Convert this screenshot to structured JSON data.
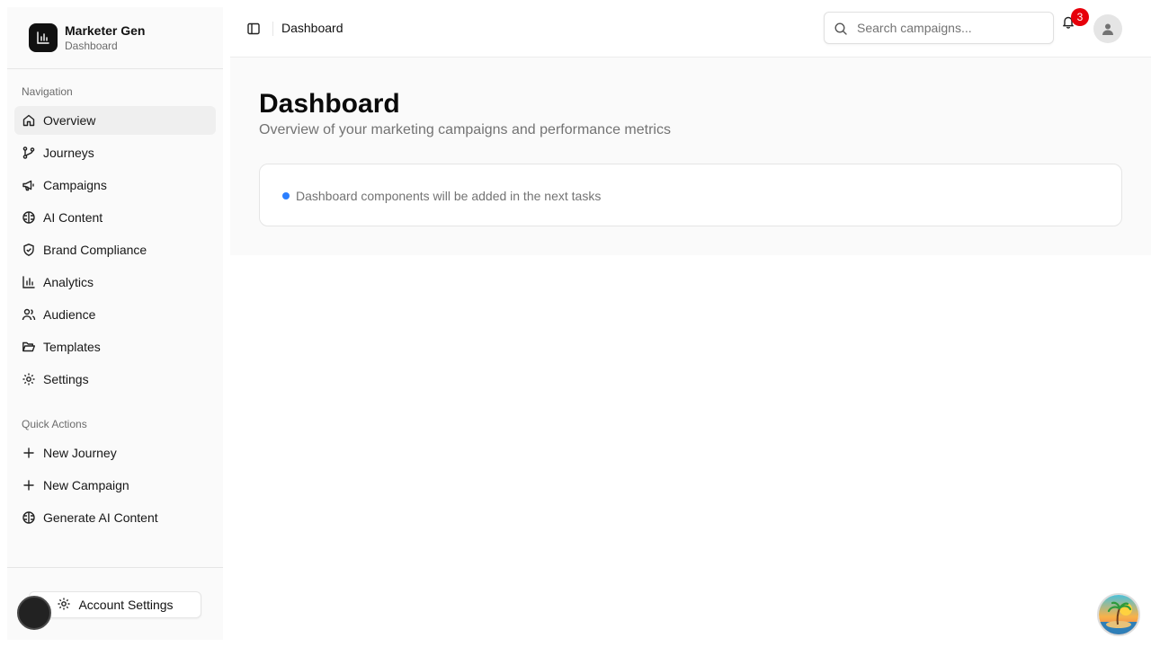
{
  "brand": {
    "title": "Marketer Gen",
    "subtitle": "Dashboard"
  },
  "sidebar": {
    "nav_label": "Navigation",
    "nav_items": [
      {
        "label": "Overview",
        "icon": "home-icon",
        "active": true
      },
      {
        "label": "Journeys",
        "icon": "git-branch-icon"
      },
      {
        "label": "Campaigns",
        "icon": "megaphone-icon"
      },
      {
        "label": "AI Content",
        "icon": "brain-icon"
      },
      {
        "label": "Brand Compliance",
        "icon": "shield-check-icon"
      },
      {
        "label": "Analytics",
        "icon": "bar-chart-icon"
      },
      {
        "label": "Audience",
        "icon": "users-icon"
      },
      {
        "label": "Templates",
        "icon": "folder-open-icon"
      },
      {
        "label": "Settings",
        "icon": "gear-icon"
      }
    ],
    "quick_label": "Quick Actions",
    "quick_items": [
      {
        "label": "New Journey",
        "icon": "plus-icon"
      },
      {
        "label": "New Campaign",
        "icon": "plus-icon"
      },
      {
        "label": "Generate AI Content",
        "icon": "brain-icon"
      }
    ],
    "account_button": "Account Settings"
  },
  "header": {
    "title": "Dashboard",
    "search_placeholder": "Search campaigns...",
    "notification_count": "3"
  },
  "main": {
    "title": "Dashboard",
    "subtitle": "Overview of your marketing campaigns and performance metrics",
    "notice": "Dashboard components will be added in the next tasks"
  },
  "colors": {
    "accent_dot": "#2b7fff",
    "badge": "#e7000b",
    "logo_bg": "#111111"
  }
}
